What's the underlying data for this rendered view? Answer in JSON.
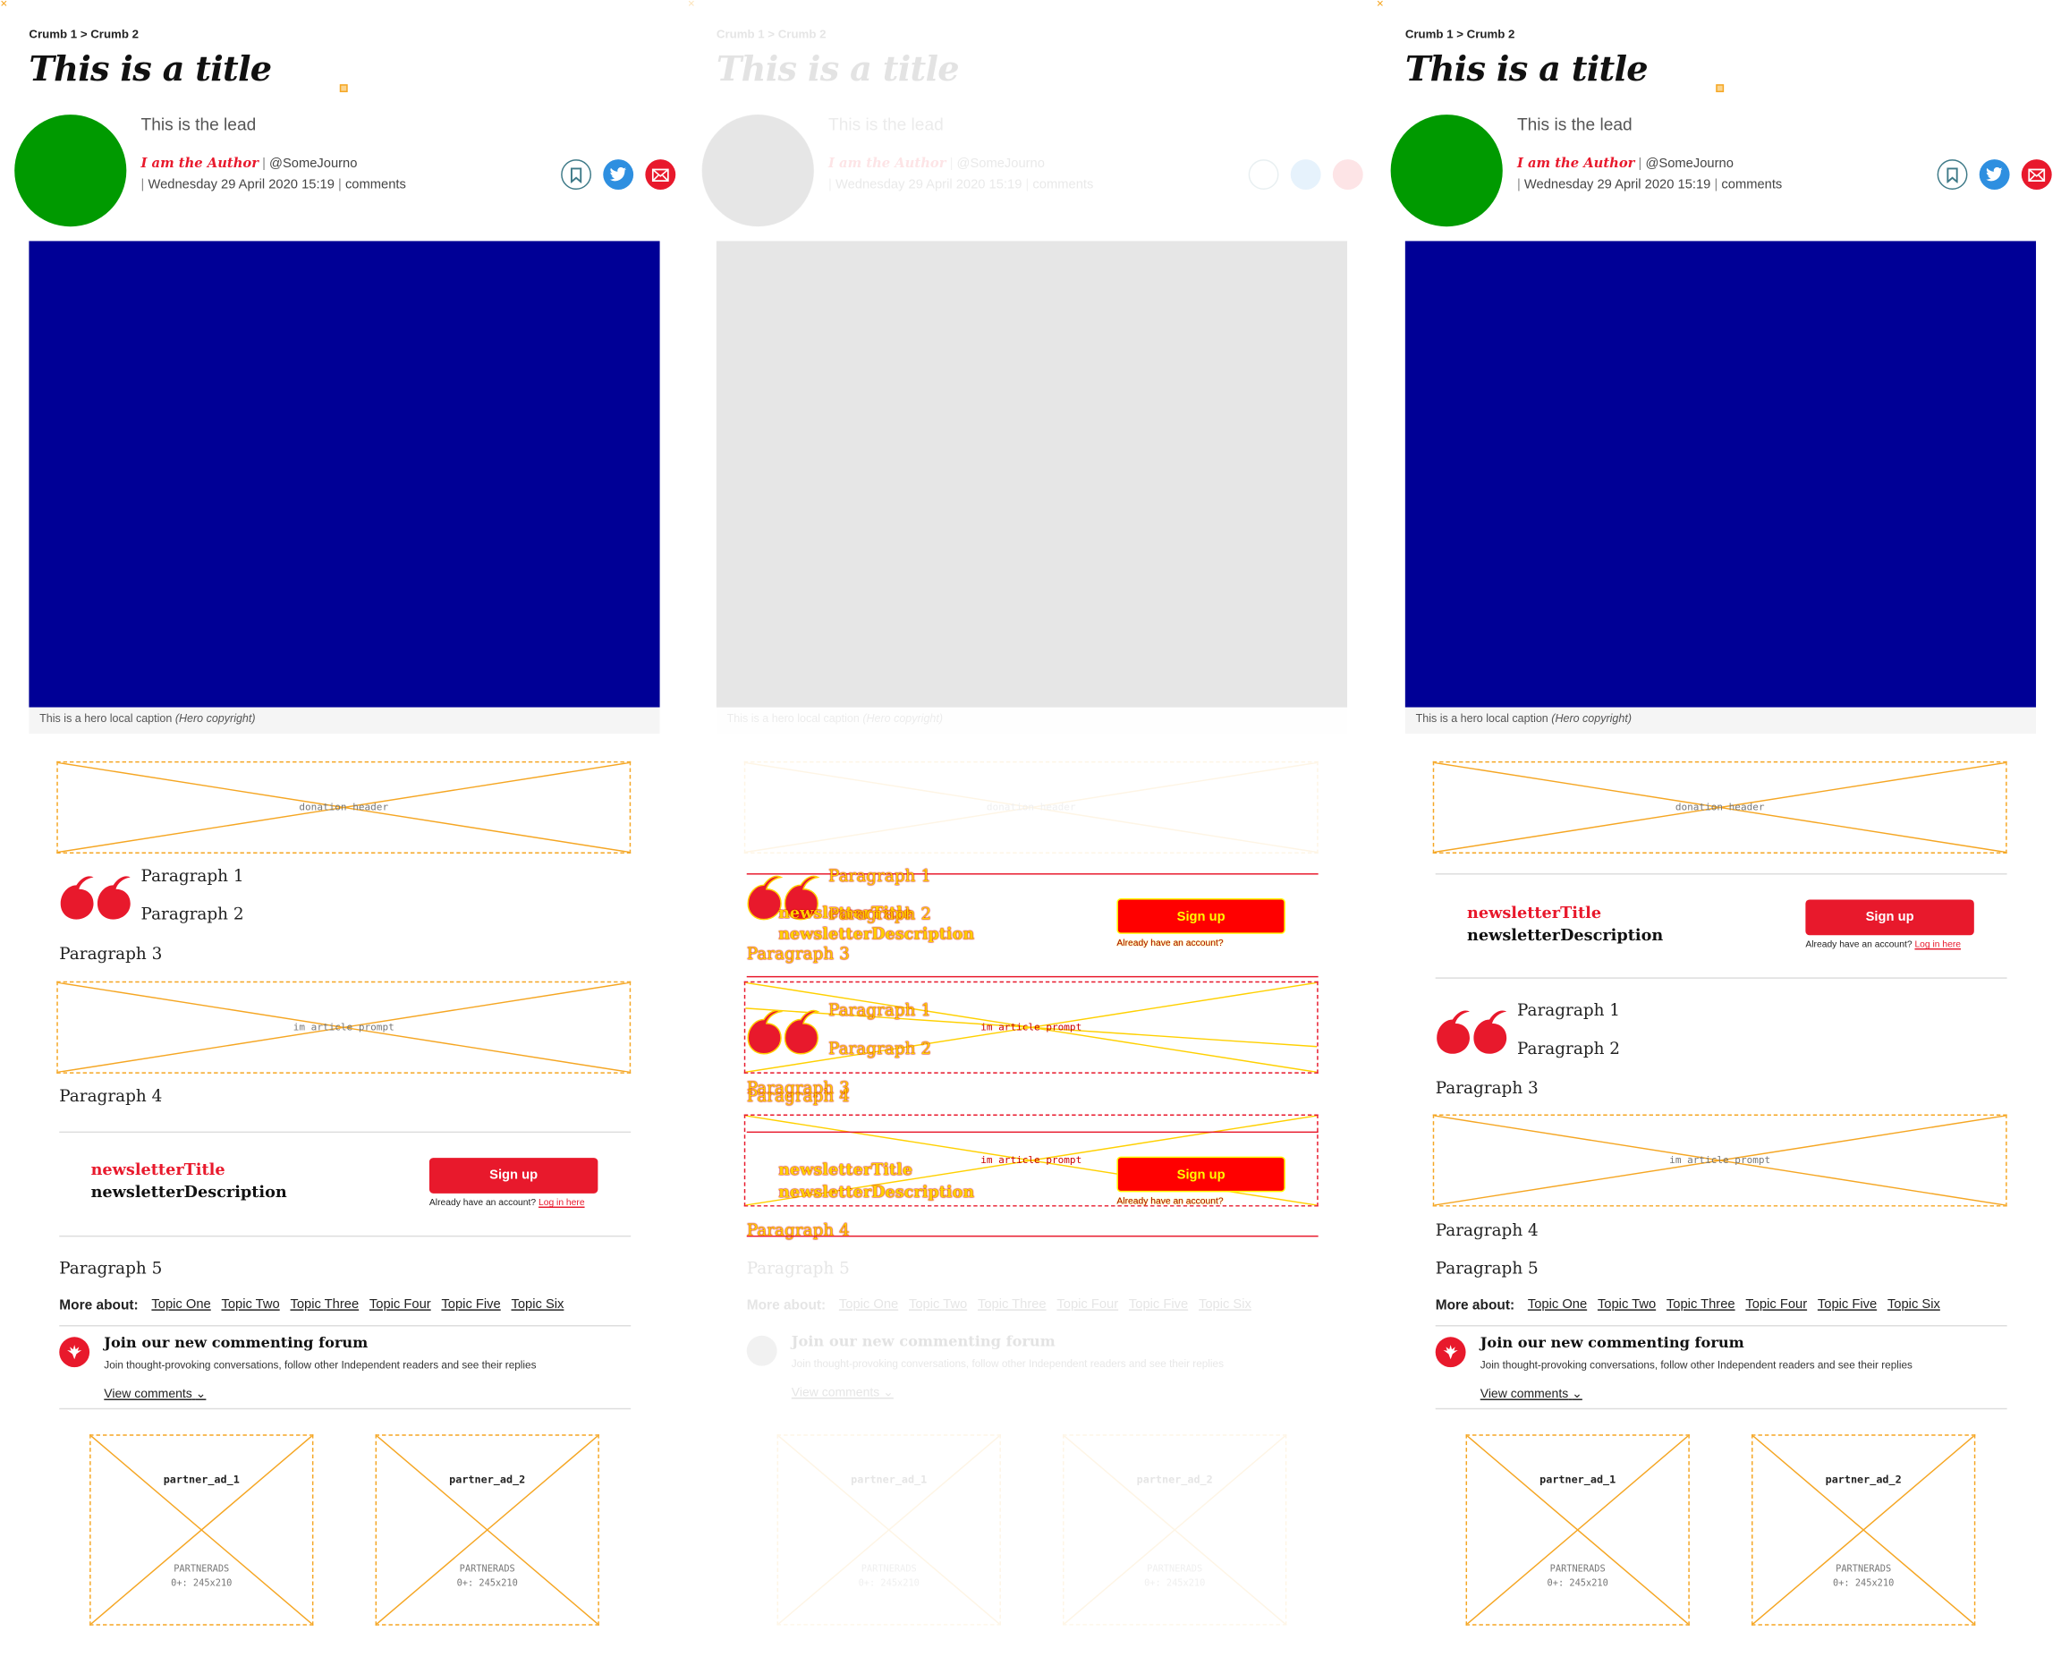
{
  "breadcrumb": "Crumb 1 > Crumb 2",
  "title": "This is a title",
  "lead": "This is the lead",
  "author": "I am the Author",
  "handle": "@SomeJourno",
  "date": "Wednesday 29 April 2020 15:19",
  "comments": "comments",
  "caption": "This is a hero local caption",
  "copyright": "(Hero copyright)",
  "donation_header": "donation header",
  "in_article_prompt": "im article prompt",
  "paragraphs": [
    "Paragraph 1",
    "Paragraph 2",
    "Paragraph 3",
    "Paragraph 4",
    "Paragraph 5"
  ],
  "newsletter": {
    "title": "newsletterTitle",
    "description": "newsletterDescription",
    "button": "Sign up",
    "already": "Already have an account?",
    "login": "Log in here"
  },
  "more_about": {
    "label": "More about:",
    "topics": [
      "Topic One",
      "Topic Two",
      "Topic Three",
      "Topic Four",
      "Topic Five",
      "Topic Six"
    ]
  },
  "forum": {
    "title": "Join our new commenting forum",
    "subtitle": "Join thought-provoking conversations, follow other Independent readers and see their replies",
    "view": "View comments"
  },
  "ads": [
    {
      "name": "partner_ad_1",
      "tag": "PARTNERADS",
      "size": "0+: 245x210"
    },
    {
      "name": "partner_ad_2",
      "tag": "PARTNERADS",
      "size": "0+: 245x210"
    }
  ],
  "colors": {
    "brand_red": "#e8192c",
    "avatar_green": "#009a00",
    "hero_blue": "#000096",
    "placeholder_orange": "#f5a623"
  },
  "icons": [
    "bookmark-icon",
    "twitter-icon",
    "email-icon",
    "quote-icon",
    "independent-logo-icon",
    "chevron-down-icon"
  ]
}
